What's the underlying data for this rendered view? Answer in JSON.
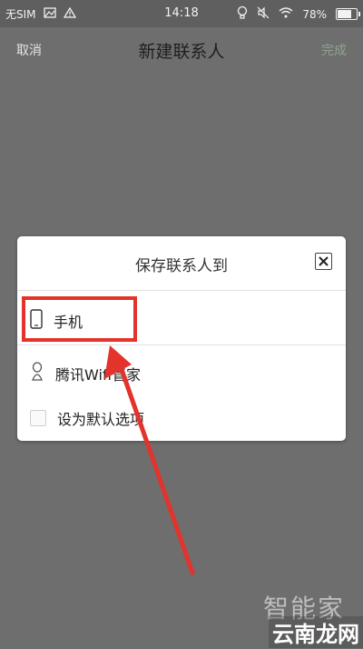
{
  "status_bar": {
    "carrier": "无SIM",
    "time": "14:18",
    "battery_percent": "78%",
    "battery_level": 0.78
  },
  "header": {
    "cancel_label": "取消",
    "title": "新建联系人",
    "done_label": "完成"
  },
  "dialog": {
    "title": "保存联系人到",
    "options": [
      {
        "label": "手机",
        "icon": "phone-icon"
      },
      {
        "label": "腾讯Wifi管家",
        "icon": "tencent-icon"
      }
    ],
    "default_option_label": "设为默认选项"
  },
  "watermark": {
    "line1": "智能家",
    "line2": "云南龙网"
  },
  "colors": {
    "highlight": "#e2332c",
    "backdrop": "#6e6e6e",
    "done_text": "#8ea38e"
  }
}
